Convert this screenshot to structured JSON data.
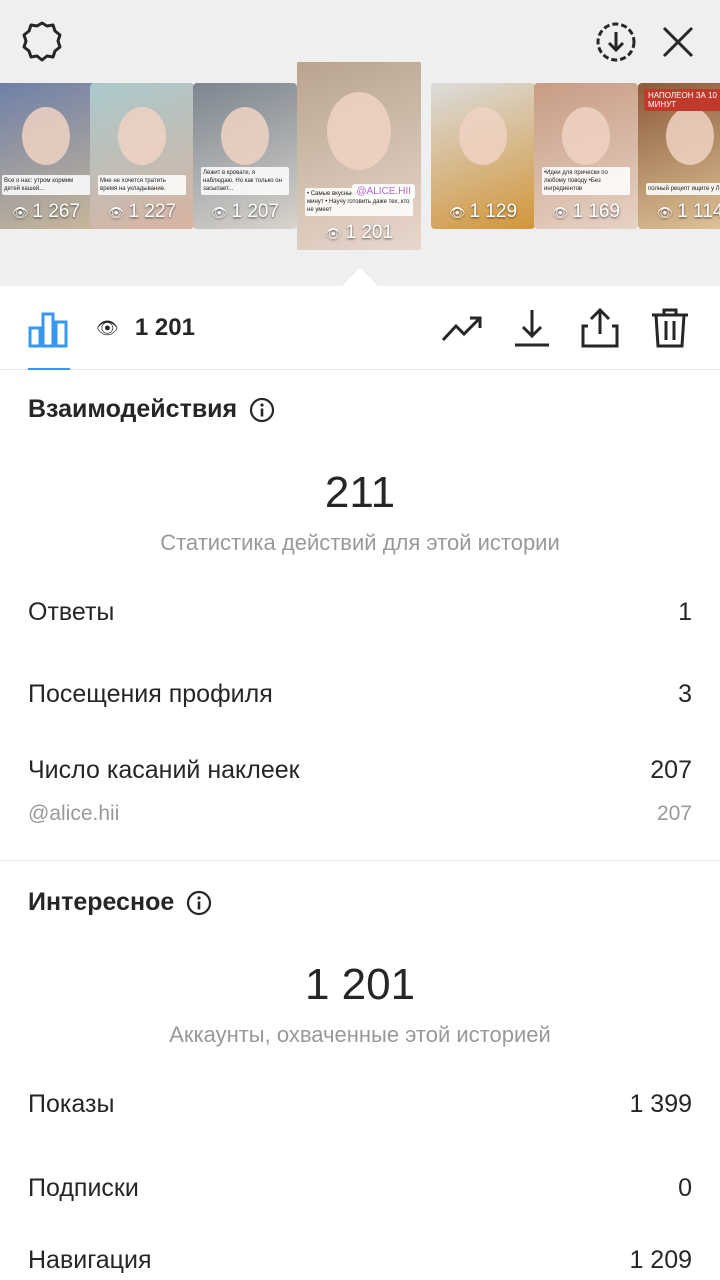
{
  "thumbs": [
    {
      "views": "1 267",
      "caption": "Все о нас: утром кормим детей кашей...",
      "colors": [
        "#6d7fa8",
        "#c9b79a"
      ]
    },
    {
      "views": "1 227",
      "caption": "Мне не хочется тратить время на укладывание.",
      "colors": [
        "#a9c9cc",
        "#d9b3a1"
      ]
    },
    {
      "views": "1 207",
      "caption": "Лежит в кровати, я наблюдаю. Но как только он засыпает...",
      "colors": [
        "#7c8590",
        "#d8d3cc"
      ]
    },
    {
      "views": "1 201",
      "caption": "• Самые вкусные блюда за пять минут • Научу готовить даже тех, кто не умеет",
      "tag": "@ALICE.HII",
      "colors": [
        "#b8a48f",
        "#e8d7cc"
      ]
    },
    {
      "views": "1 129",
      "caption": "",
      "colors": [
        "#dcdcdc",
        "#d2963a"
      ]
    },
    {
      "views": "1 169",
      "caption": "•Идеи для прически по любому поводу •Без ингредиентов",
      "colors": [
        "#c89c84",
        "#e6d2c6"
      ]
    },
    {
      "views": "1 114",
      "caption": "полный рецепт ищите у Лены",
      "tag": "НАПОЛЕОН ЗА 10 МИНУТ",
      "colors": [
        "#8c5a3a",
        "#e2c79b"
      ]
    }
  ],
  "toolbar": {
    "views": "1 201"
  },
  "interactions": {
    "title": "Взаимодействия",
    "total": "211",
    "subtitle": "Статистика действий для этой истории",
    "rows": [
      {
        "label": "Ответы",
        "value": "1"
      },
      {
        "label": "Посещения профиля",
        "value": "3"
      },
      {
        "label": "Число касаний наклеек",
        "value": "207"
      }
    ],
    "sticker": {
      "label": "@alice.hii",
      "value": "207"
    }
  },
  "discovery": {
    "title": "Интересное",
    "total": "1 201",
    "subtitle": "Аккаунты, охваченные этой историей",
    "rows": [
      {
        "label": "Показы",
        "value": "1 399"
      },
      {
        "label": "Подписки",
        "value": "0"
      },
      {
        "label": "Навигация",
        "value": "1 209"
      }
    ]
  },
  "colors": {
    "accent": "#3897f0",
    "text": "#262626",
    "muted": "#999999",
    "top_bg": "#efefef"
  },
  "icons": {
    "settings": "gear-icon",
    "save": "download-circle-icon",
    "close": "close-icon",
    "chart": "bar-chart-icon",
    "eye": "eye-icon",
    "promote": "trend-up-icon",
    "download": "download-icon",
    "share": "share-icon",
    "delete": "trash-icon",
    "info": "info-icon"
  }
}
